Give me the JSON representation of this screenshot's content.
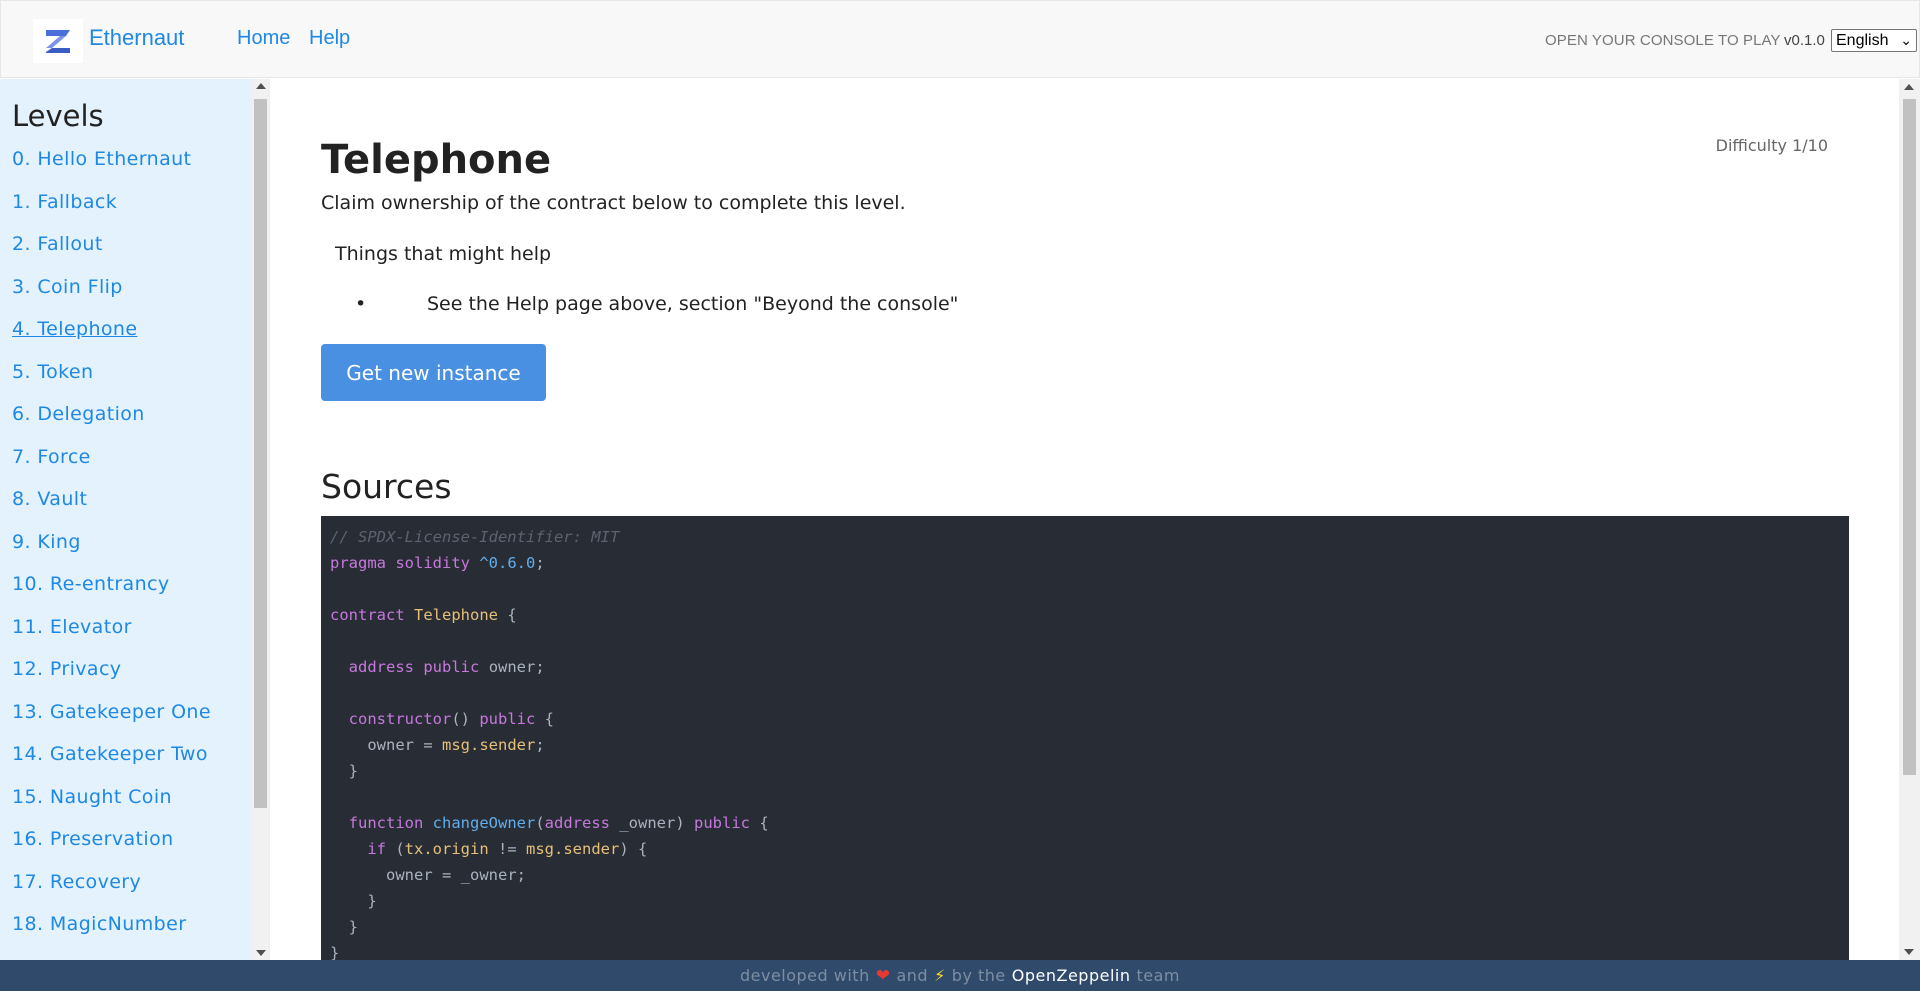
{
  "header": {
    "brand": "Ethernaut",
    "nav": [
      "Home",
      "Help"
    ],
    "console_message": "OPEN YOUR CONSOLE TO PLAY",
    "version": "v0.1.0",
    "language": "English",
    "accent_color": "#1e88e5"
  },
  "sidebar": {
    "title": "Levels",
    "levels": [
      "0. Hello Ethernaut",
      "1. Fallback",
      "2. Fallout",
      "3. Coin Flip",
      "4. Telephone",
      "5. Token",
      "6. Delegation",
      "7. Force",
      "8. Vault",
      "9. King",
      "10. Re-entrancy",
      "11. Elevator",
      "12. Privacy",
      "13. Gatekeeper One",
      "14. Gatekeeper Two",
      "15. Naught Coin",
      "16. Preservation",
      "17. Recovery",
      "18. MagicNumber"
    ],
    "active_level": "4. Telephone"
  },
  "main": {
    "title": "Telephone",
    "difficulty": "Difficulty 1/10",
    "description": "Claim ownership of the contract below to complete this level.",
    "help_heading": "Things that might help",
    "help_items": [
      "See the Help page above, section \"Beyond the console\""
    ],
    "button_label": "Get new instance",
    "sources_title": "Sources",
    "source_code": {
      "comment": "// SPDX-License-Identifier: MIT",
      "pragma": "pragma",
      "solidity": "solidity",
      "version": "^0.6.0",
      "contract_kw": "contract",
      "contract_name": "Telephone",
      "address_kw": "address",
      "public_kw": "public",
      "owner_var": "owner",
      "constructor_kw": "constructor",
      "msg_sender": "msg.sender",
      "function_kw": "function",
      "change_owner_fn": "changeOwner",
      "owner_param": "_owner",
      "if_kw": "if",
      "tx_origin": "tx.origin"
    }
  },
  "footer": {
    "prefix": "developed with",
    "and": "and",
    "by": "by the",
    "brand": "OpenZeppelin",
    "suffix": "team"
  }
}
